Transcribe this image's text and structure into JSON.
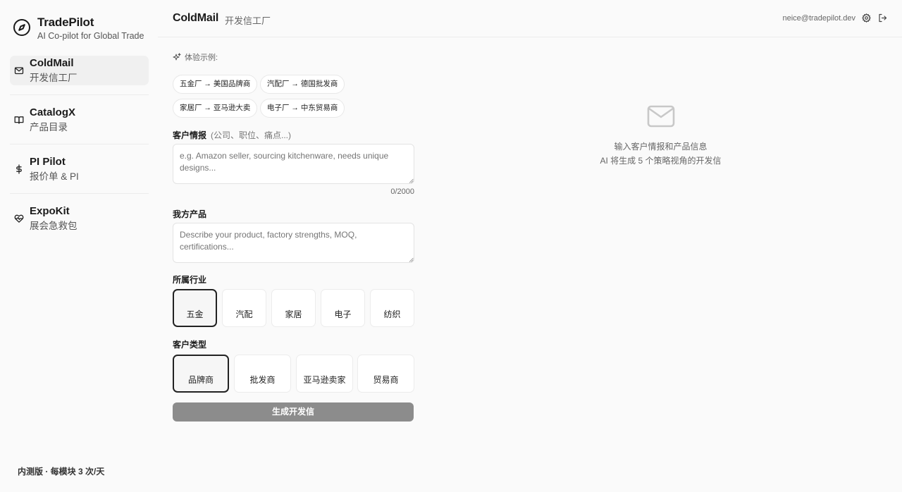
{
  "brand": {
    "name": "TradePilot",
    "tagline": "AI Co-pilot for Global Trade",
    "logo_icon": "compass-icon"
  },
  "nav": [
    {
      "title": "ColdMail",
      "sub": "开发信工厂",
      "icon": "mail-icon",
      "active": true
    },
    {
      "title": "CatalogX",
      "sub": "产品目录",
      "icon": "book-icon",
      "active": false
    },
    {
      "title": "PI Pilot",
      "sub": "报价单 & PI",
      "icon": "dollar-icon",
      "active": false
    },
    {
      "title": "ExpoKit",
      "sub": "展会急救包",
      "icon": "heart-pulse-icon",
      "active": false
    }
  ],
  "sidebar_footer": "内测版 · 每模块 3 次/天",
  "header": {
    "title": "ColdMail",
    "subtitle": "开发信工厂",
    "email": "neice@tradepilot.dev",
    "settings_icon": "gear-icon",
    "logout_icon": "logout-icon"
  },
  "examples": {
    "label": "体验示例:",
    "chips": [
      "五金厂 → 美国品牌商",
      "汽配厂 → 德国批发商",
      "家居厂 → 亚马逊大卖",
      "电子厂 → 中东贸易商"
    ]
  },
  "customer_info": {
    "label": "客户情报",
    "hint": "(公司、职位、痛点...)",
    "placeholder": "e.g. Amazon seller, sourcing kitchenware, needs unique designs...",
    "counter": "0/2000"
  },
  "product": {
    "label": "我方产品",
    "placeholder": "Describe your product, factory strengths, MOQ, certifications..."
  },
  "industry": {
    "label": "所属行业",
    "options": [
      "五金",
      "汽配",
      "家居",
      "电子",
      "纺织"
    ],
    "selected": "五金"
  },
  "customer_type": {
    "label": "客户类型",
    "options": [
      "品牌商",
      "批发商",
      "亚马逊卖家",
      "贸易商"
    ],
    "selected": "品牌商"
  },
  "submit_label": "生成开发信",
  "empty_state": {
    "line1": "输入客户情报和产品信息",
    "line2": "AI 将生成 5 个策略视角的开发信"
  },
  "colors": {
    "background": "#fafafa",
    "accent": "#1a1a1a",
    "button_disabled": "#8c8c8c"
  }
}
